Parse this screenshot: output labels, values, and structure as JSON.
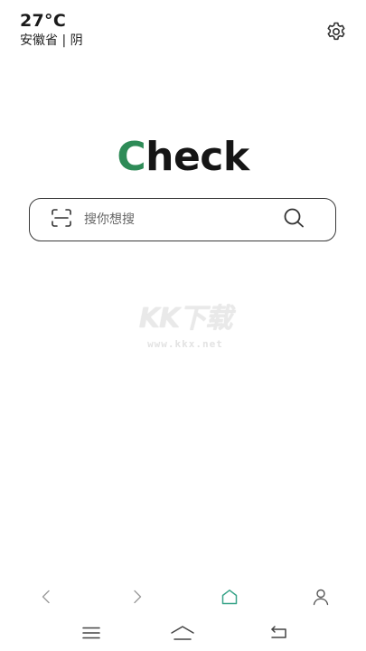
{
  "weather": {
    "temperature": "27°C",
    "location": "安徽省 | 阴",
    "settings_icon": "gear-icon"
  },
  "logo": {
    "first_letter": "C",
    "rest": "heck",
    "accent_color": "#2e8b57"
  },
  "search": {
    "placeholder": "搜你想搜",
    "scan_icon": "scan-icon",
    "search_icon": "search-icon"
  },
  "watermark": {
    "logo_text": "KK下载",
    "url": "www.kkx.net"
  },
  "browser_nav": {
    "items": [
      {
        "icon": "back-arrow-icon"
      },
      {
        "icon": "forward-arrow-icon"
      },
      {
        "icon": "home-icon",
        "active_color": "#3aa58a"
      },
      {
        "icon": "profile-icon"
      }
    ]
  },
  "system_nav": {
    "items": [
      {
        "icon": "menu-icon"
      },
      {
        "icon": "home-icon"
      },
      {
        "icon": "back-icon"
      }
    ]
  }
}
